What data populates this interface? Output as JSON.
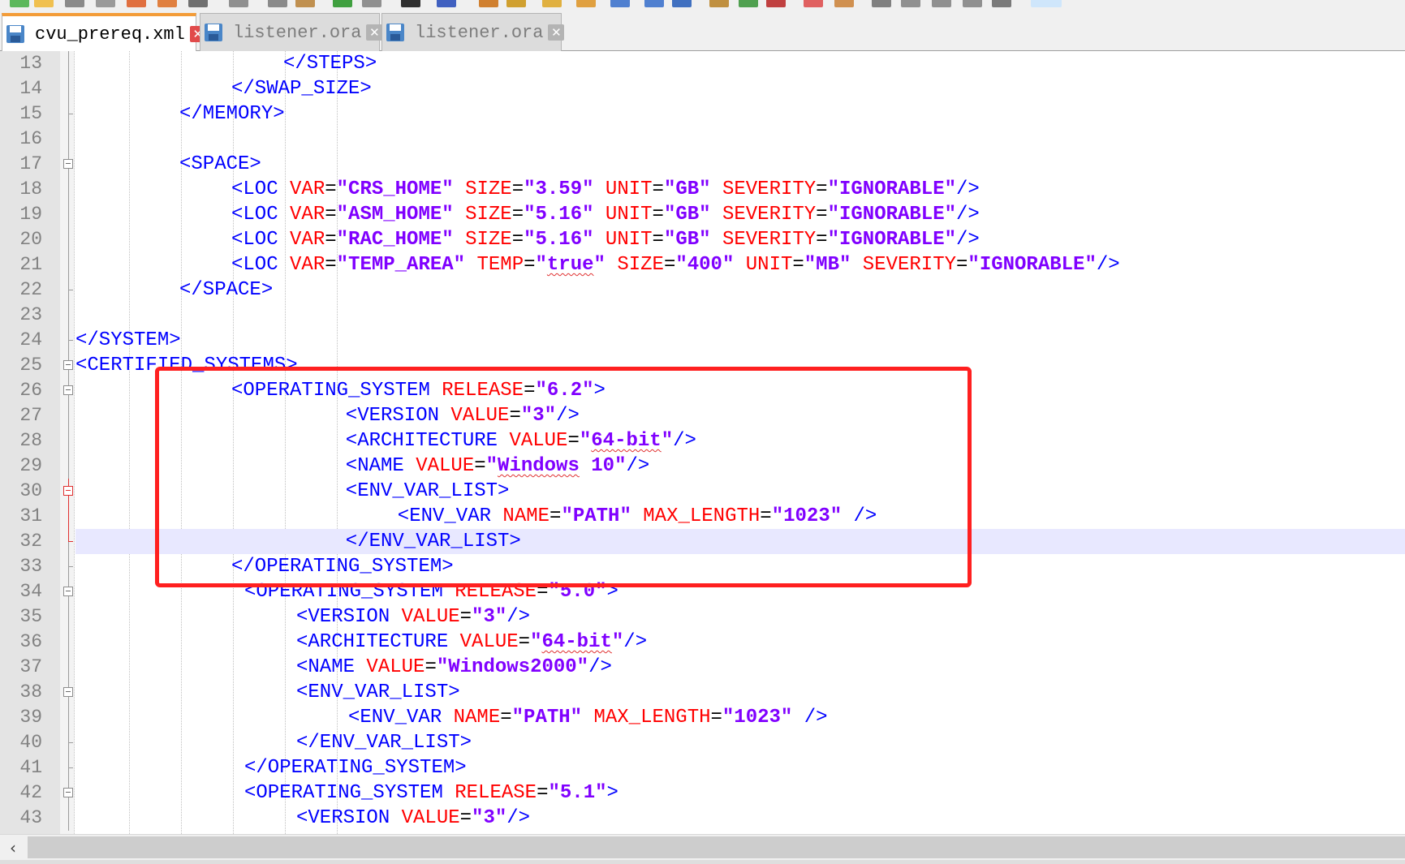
{
  "tabs": [
    {
      "label": "cvu_prereq.xml",
      "active": true
    },
    {
      "label": "listener.ora",
      "active": false
    },
    {
      "label": "listener.ora",
      "active": false
    }
  ],
  "colors": {
    "tag": "#0000ff",
    "attribute": "#ff0000",
    "operator": "#000000",
    "value": "#8000ff",
    "highlight_box": "#ff2020",
    "active_tab_accent": "#f39c38"
  },
  "lines": [
    {
      "n": "13",
      "indent": 4,
      "fold": "line",
      "tokens": [
        [
          "t",
          "</STEPS>"
        ]
      ]
    },
    {
      "n": "14",
      "indent": 3,
      "fold": "line",
      "tokens": [
        [
          "t",
          "</SWAP_SIZE>"
        ]
      ]
    },
    {
      "n": "15",
      "indent": 2,
      "fold": "end",
      "tokens": [
        [
          "t",
          "</MEMORY>"
        ]
      ]
    },
    {
      "n": "16",
      "indent": 0,
      "fold": "line",
      "tokens": []
    },
    {
      "n": "17",
      "indent": 2,
      "fold": "box",
      "tokens": [
        [
          "t",
          "<SPACE>"
        ]
      ]
    },
    {
      "n": "18",
      "indent": 3,
      "fold": "line",
      "tokens": [
        [
          "t",
          "<LOC "
        ],
        [
          "a",
          "VAR"
        ],
        [
          "o",
          "="
        ],
        [
          "v",
          "\"CRS_HOME\""
        ],
        [
          "t",
          " "
        ],
        [
          "a",
          "SIZE"
        ],
        [
          "o",
          "="
        ],
        [
          "v",
          "\"3.59\""
        ],
        [
          "t",
          " "
        ],
        [
          "a",
          "UNIT"
        ],
        [
          "o",
          "="
        ],
        [
          "v",
          "\"GB\""
        ],
        [
          "t",
          " "
        ],
        [
          "a",
          "SEVERITY"
        ],
        [
          "o",
          "="
        ],
        [
          "v",
          "\"IGNORABLE\""
        ],
        [
          "t",
          "/>"
        ]
      ]
    },
    {
      "n": "19",
      "indent": 3,
      "fold": "line",
      "tokens": [
        [
          "t",
          "<LOC "
        ],
        [
          "a",
          "VAR"
        ],
        [
          "o",
          "="
        ],
        [
          "v",
          "\"ASM_HOME\""
        ],
        [
          "t",
          " "
        ],
        [
          "a",
          "SIZE"
        ],
        [
          "o",
          "="
        ],
        [
          "v",
          "\"5.16\""
        ],
        [
          "t",
          " "
        ],
        [
          "a",
          "UNIT"
        ],
        [
          "o",
          "="
        ],
        [
          "v",
          "\"GB\""
        ],
        [
          "t",
          " "
        ],
        [
          "a",
          "SEVERITY"
        ],
        [
          "o",
          "="
        ],
        [
          "v",
          "\"IGNORABLE\""
        ],
        [
          "t",
          "/>"
        ]
      ]
    },
    {
      "n": "20",
      "indent": 3,
      "fold": "line",
      "tokens": [
        [
          "t",
          "<LOC "
        ],
        [
          "a",
          "VAR"
        ],
        [
          "o",
          "="
        ],
        [
          "v",
          "\"RAC_HOME\""
        ],
        [
          "t",
          " "
        ],
        [
          "a",
          "SIZE"
        ],
        [
          "o",
          "="
        ],
        [
          "v",
          "\"5.16\""
        ],
        [
          "t",
          " "
        ],
        [
          "a",
          "UNIT"
        ],
        [
          "o",
          "="
        ],
        [
          "v",
          "\"GB\""
        ],
        [
          "t",
          " "
        ],
        [
          "a",
          "SEVERITY"
        ],
        [
          "o",
          "="
        ],
        [
          "v",
          "\"IGNORABLE\""
        ],
        [
          "t",
          "/>"
        ]
      ]
    },
    {
      "n": "21",
      "indent": 3,
      "fold": "line",
      "tokens": [
        [
          "t",
          "<LOC "
        ],
        [
          "a",
          "VAR"
        ],
        [
          "o",
          "="
        ],
        [
          "v",
          "\"TEMP_AREA\""
        ],
        [
          "t",
          " "
        ],
        [
          "a",
          "TEMP"
        ],
        [
          "o",
          "="
        ],
        [
          "v",
          "\""
        ],
        [
          "vs",
          "true"
        ],
        [
          "v",
          "\""
        ],
        [
          "t",
          " "
        ],
        [
          "a",
          "SIZE"
        ],
        [
          "o",
          "="
        ],
        [
          "v",
          "\"400\""
        ],
        [
          "t",
          " "
        ],
        [
          "a",
          "UNIT"
        ],
        [
          "o",
          "="
        ],
        [
          "v",
          "\"MB\""
        ],
        [
          "t",
          " "
        ],
        [
          "a",
          "SEVERITY"
        ],
        [
          "o",
          "="
        ],
        [
          "v",
          "\"IGNORABLE\""
        ],
        [
          "t",
          "/>"
        ]
      ]
    },
    {
      "n": "22",
      "indent": 2,
      "fold": "end",
      "tokens": [
        [
          "t",
          "</SPACE>"
        ]
      ]
    },
    {
      "n": "23",
      "indent": 0,
      "fold": "line",
      "tokens": []
    },
    {
      "n": "24",
      "indent": 0,
      "fold": "end",
      "tokens": [
        [
          "t",
          "</SYSTEM>"
        ]
      ]
    },
    {
      "n": "25",
      "indent": 0,
      "fold": "box",
      "tokens": [
        [
          "t",
          "<CERTIFIED_SYSTEMS>"
        ]
      ]
    },
    {
      "n": "26",
      "indent": 3,
      "fold": "box",
      "tokens": [
        [
          "t",
          "<OPERATING_SYSTEM "
        ],
        [
          "a",
          "RELEASE"
        ],
        [
          "o",
          "="
        ],
        [
          "v",
          "\"6.2\""
        ],
        [
          "t",
          ">"
        ]
      ]
    },
    {
      "n": "27",
      "indent": 5.2,
      "fold": "line",
      "tokens": [
        [
          "t",
          "<VERSION "
        ],
        [
          "a",
          "VALUE"
        ],
        [
          "o",
          "="
        ],
        [
          "v",
          "\"3\""
        ],
        [
          "t",
          "/>"
        ]
      ]
    },
    {
      "n": "28",
      "indent": 5.2,
      "fold": "line",
      "tokens": [
        [
          "t",
          "<ARCHITECTURE "
        ],
        [
          "a",
          "VALUE"
        ],
        [
          "o",
          "="
        ],
        [
          "v",
          "\""
        ],
        [
          "vs",
          "64-bit"
        ],
        [
          "v",
          "\""
        ],
        [
          "t",
          "/>"
        ]
      ]
    },
    {
      "n": "29",
      "indent": 5.2,
      "fold": "line",
      "tokens": [
        [
          "t",
          "<NAME "
        ],
        [
          "a",
          "VALUE"
        ],
        [
          "o",
          "="
        ],
        [
          "v",
          "\""
        ],
        [
          "vs",
          "Windows"
        ],
        [
          "v",
          " 10\""
        ],
        [
          "t",
          "/>"
        ]
      ]
    },
    {
      "n": "30",
      "indent": 5.2,
      "fold": "boxred",
      "tokens": [
        [
          "t",
          "<ENV_VAR_LIST>"
        ]
      ]
    },
    {
      "n": "31",
      "indent": 6.2,
      "fold": "linered",
      "tokens": [
        [
          "t",
          "<ENV_VAR "
        ],
        [
          "a",
          "NAME"
        ],
        [
          "o",
          "="
        ],
        [
          "v",
          "\"PATH\""
        ],
        [
          "t",
          " "
        ],
        [
          "a",
          "MAX_LENGTH"
        ],
        [
          "o",
          "="
        ],
        [
          "v",
          "\"1023\""
        ],
        [
          "t",
          " />"
        ]
      ]
    },
    {
      "n": "32",
      "indent": 5.2,
      "fold": "endred",
      "current": true,
      "tokens": [
        [
          "t",
          "</ENV_VAR_LIST>"
        ]
      ]
    },
    {
      "n": "33",
      "indent": 3,
      "fold": "end",
      "tokens": [
        [
          "t",
          "</OPERATING_SYSTEM>"
        ]
      ]
    },
    {
      "n": "34",
      "indent": 3.25,
      "fold": "box",
      "tokens": [
        [
          "t",
          "<OPERATING_SYSTEM "
        ],
        [
          "a",
          "RELEASE"
        ],
        [
          "o",
          "="
        ],
        [
          "v",
          "\"5.0\""
        ],
        [
          "t",
          ">"
        ]
      ]
    },
    {
      "n": "35",
      "indent": 4.25,
      "fold": "line",
      "tokens": [
        [
          "t",
          "<VERSION "
        ],
        [
          "a",
          "VALUE"
        ],
        [
          "o",
          "="
        ],
        [
          "v",
          "\"3\""
        ],
        [
          "t",
          "/>"
        ]
      ]
    },
    {
      "n": "36",
      "indent": 4.25,
      "fold": "line",
      "tokens": [
        [
          "t",
          "<ARCHITECTURE "
        ],
        [
          "a",
          "VALUE"
        ],
        [
          "o",
          "="
        ],
        [
          "v",
          "\""
        ],
        [
          "vs",
          "64-bit"
        ],
        [
          "v",
          "\""
        ],
        [
          "t",
          "/>"
        ]
      ]
    },
    {
      "n": "37",
      "indent": 4.25,
      "fold": "line",
      "tokens": [
        [
          "t",
          "<NAME "
        ],
        [
          "a",
          "VALUE"
        ],
        [
          "o",
          "="
        ],
        [
          "v",
          "\"Windows2000\""
        ],
        [
          "t",
          "/>"
        ]
      ]
    },
    {
      "n": "38",
      "indent": 4.25,
      "fold": "box",
      "tokens": [
        [
          "t",
          "<ENV_VAR_LIST>"
        ]
      ]
    },
    {
      "n": "39",
      "indent": 5.25,
      "fold": "line",
      "tokens": [
        [
          "t",
          "<ENV_VAR "
        ],
        [
          "a",
          "NAME"
        ],
        [
          "o",
          "="
        ],
        [
          "v",
          "\"PATH\""
        ],
        [
          "t",
          " "
        ],
        [
          "a",
          "MAX_LENGTH"
        ],
        [
          "o",
          "="
        ],
        [
          "v",
          "\"1023\""
        ],
        [
          "t",
          " />"
        ]
      ]
    },
    {
      "n": "40",
      "indent": 4.25,
      "fold": "end",
      "tokens": [
        [
          "t",
          "</ENV_VAR_LIST>"
        ]
      ]
    },
    {
      "n": "41",
      "indent": 3.25,
      "fold": "end",
      "tokens": [
        [
          "t",
          "</OPERATING_SYSTEM>"
        ]
      ]
    },
    {
      "n": "42",
      "indent": 3.25,
      "fold": "box",
      "tokens": [
        [
          "t",
          "<OPERATING_SYSTEM "
        ],
        [
          "a",
          "RELEASE"
        ],
        [
          "o",
          "="
        ],
        [
          "v",
          "\"5.1\""
        ],
        [
          "t",
          ">"
        ]
      ]
    },
    {
      "n": "43",
      "indent": 4.25,
      "fold": "line",
      "tokens": [
        [
          "t",
          "<VERSION "
        ],
        [
          "a",
          "VALUE"
        ],
        [
          "o",
          "="
        ],
        [
          "v",
          "\"3\""
        ],
        [
          "t",
          "/>"
        ]
      ]
    }
  ],
  "scrollbar": {
    "left_arrow": "‹"
  }
}
